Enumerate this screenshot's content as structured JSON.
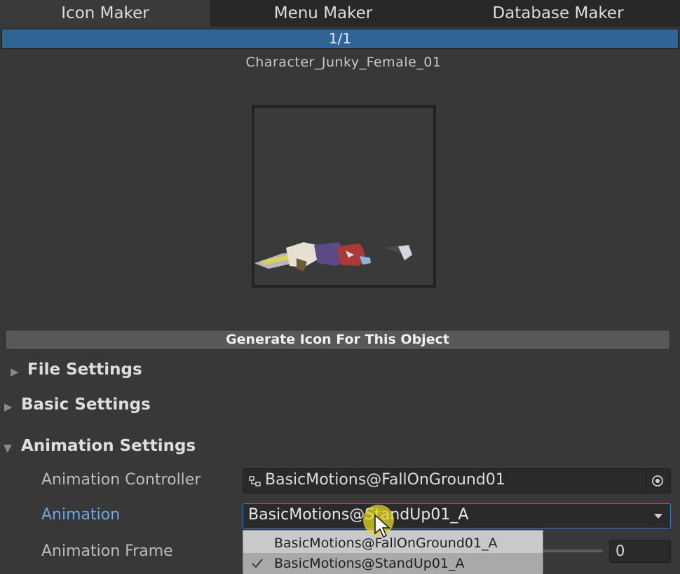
{
  "tabs": [
    {
      "label": "Icon Maker",
      "active": true
    },
    {
      "label": "Menu Maker",
      "active": false
    },
    {
      "label": "Database Maker",
      "active": false
    }
  ],
  "progress": {
    "text": "1/1",
    "fraction": 1.0
  },
  "object_name": "Character_Junky_Female_01",
  "preview": {
    "icon": "character-preview-image"
  },
  "generate_button": "Generate Icon For This Object",
  "sections": {
    "file": {
      "label": "File Settings",
      "expanded": false
    },
    "basic": {
      "label": "Basic Settings",
      "expanded": false
    },
    "animation": {
      "label": "Animation Settings",
      "expanded": true
    }
  },
  "animation": {
    "controller_label": "Animation Controller",
    "controller_value": "BasicMotions@FallOnGround01",
    "animation_label": "Animation",
    "animation_value": "BasicMotions@StandUp01_A",
    "frame_label": "Animation Frame",
    "frame_value": "0",
    "options": [
      {
        "label": "BasicMotions@FallOnGround01_A",
        "selected": false
      },
      {
        "label": "BasicMotions@StandUp01_A",
        "selected": true
      }
    ]
  },
  "colors": {
    "accent": "#3a78d0",
    "progress": "#2f6497",
    "focus_label": "#6fa6e6",
    "cursor_highlight": "#e6d728"
  }
}
